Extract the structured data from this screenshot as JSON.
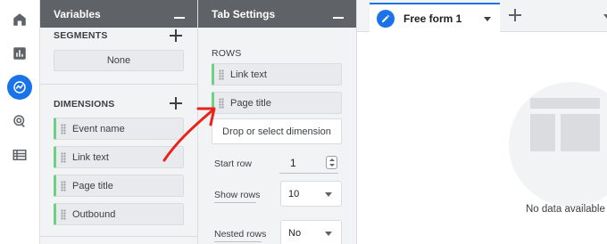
{
  "rail": {
    "items": [
      {
        "name": "home"
      },
      {
        "name": "reports"
      },
      {
        "name": "explore"
      },
      {
        "name": "advertising"
      },
      {
        "name": "configure"
      }
    ]
  },
  "variables": {
    "title": "Variables",
    "segments": {
      "title": "SEGMENTS",
      "value": "None"
    },
    "dimensions": {
      "title": "DIMENSIONS",
      "items": [
        "Event name",
        "Link text",
        "Page title",
        "Outbound"
      ]
    }
  },
  "tab_settings": {
    "title": "Tab Settings",
    "rows": {
      "title": "ROWS",
      "items": [
        "Link text",
        "Page title"
      ],
      "drop_hint": "Drop or select dimension"
    },
    "start_row": {
      "label": "Start row",
      "value": "1"
    },
    "show_rows": {
      "label": "Show rows",
      "value": "10"
    },
    "nested_rows": {
      "label": "Nested rows",
      "value": "No"
    }
  },
  "canvas": {
    "tab_label": "Free form 1",
    "empty_message": "No data available"
  },
  "colors": {
    "accent": "#1a73e8",
    "panel_header": "#5f6368",
    "chip_bar": "#6fcf84",
    "annotation_arrow": "#e8231b"
  }
}
